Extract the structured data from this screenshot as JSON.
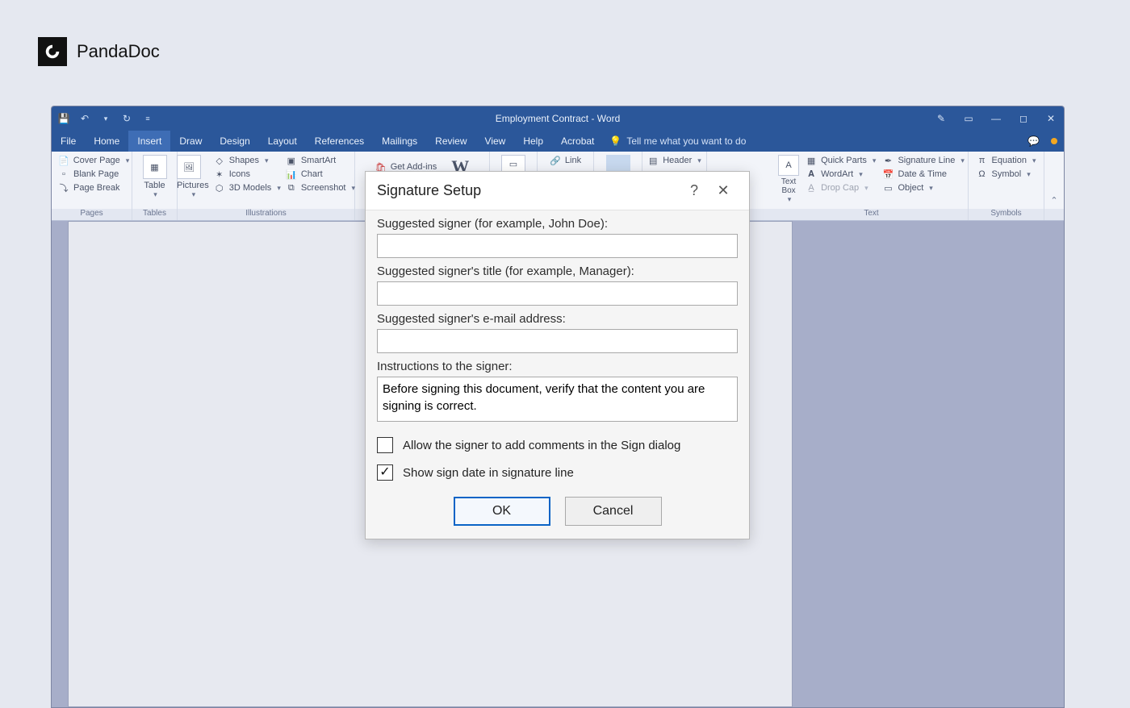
{
  "brand": {
    "name": "PandaDoc"
  },
  "window": {
    "title": "Employment Contract - Word",
    "qat": {
      "save": "save-icon",
      "undo": "undo-icon",
      "redo": "redo-icon"
    }
  },
  "tabs": {
    "file": "File",
    "home": "Home",
    "insert": "Insert",
    "draw": "Draw",
    "design": "Design",
    "layout": "Layout",
    "references": "References",
    "mailings": "Mailings",
    "review": "Review",
    "view": "View",
    "help": "Help",
    "acrobat": "Acrobat",
    "tellme": "Tell me what you want to do"
  },
  "ribbon": {
    "pages": {
      "label": "Pages",
      "cover": "Cover Page",
      "blank": "Blank Page",
      "break": "Page Break"
    },
    "tables": {
      "label": "Tables",
      "table": "Table"
    },
    "illustrations": {
      "label": "Illustrations",
      "pictures": "Pictures",
      "shapes": "Shapes",
      "icons": "Icons",
      "models": "3D Models",
      "smartart": "SmartArt",
      "chart": "Chart",
      "screenshot": "Screenshot"
    },
    "addins": {
      "getaddins": "Get Add-ins",
      "wikipedia": "W"
    },
    "links": {
      "link": "Link"
    },
    "header": {
      "header": "Header"
    },
    "textgroup": {
      "label": "Text",
      "textbox": "Text Box",
      "quickparts": "Quick Parts",
      "wordart": "WordArt",
      "dropcap": "Drop Cap",
      "sigline": "Signature Line",
      "datetime": "Date & Time",
      "object": "Object"
    },
    "symbols": {
      "label": "Symbols",
      "equation": "Equation",
      "symbol": "Symbol"
    }
  },
  "dialog": {
    "title": "Signature Setup",
    "signer_label": "Suggested signer (for example, John Doe):",
    "signer_value": "",
    "title_label": "Suggested signer's title (for example, Manager):",
    "title_value": "",
    "email_label": "Suggested signer's e-mail address:",
    "email_value": "",
    "instr_label": "Instructions to the signer:",
    "instr_value": "Before signing this document, verify that the content you are signing is correct.",
    "chk_comments": "Allow the signer to add comments in the Sign dialog",
    "chk_date": "Show sign date in signature line",
    "ok": "OK",
    "cancel": "Cancel"
  }
}
